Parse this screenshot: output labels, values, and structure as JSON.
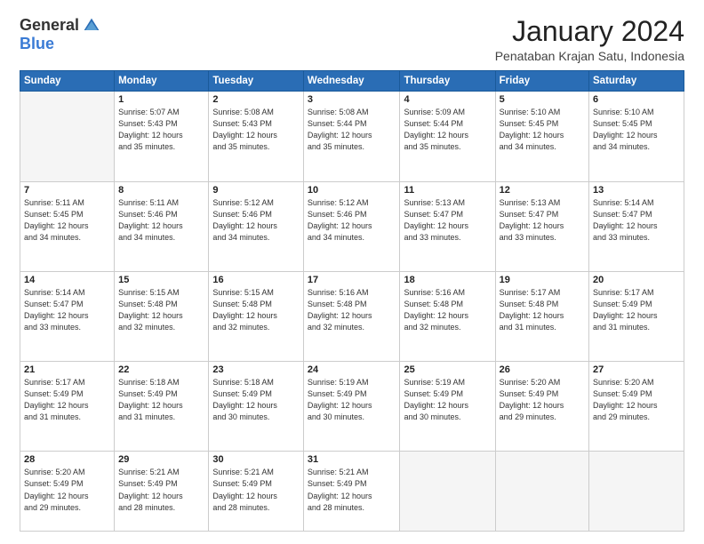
{
  "logo": {
    "general": "General",
    "blue": "Blue"
  },
  "header": {
    "month": "January 2024",
    "location": "Penataban Krajan Satu, Indonesia"
  },
  "columns": [
    "Sunday",
    "Monday",
    "Tuesday",
    "Wednesday",
    "Thursday",
    "Friday",
    "Saturday"
  ],
  "weeks": [
    [
      {
        "day": "",
        "info": ""
      },
      {
        "day": "1",
        "info": "Sunrise: 5:07 AM\nSunset: 5:43 PM\nDaylight: 12 hours\nand 35 minutes."
      },
      {
        "day": "2",
        "info": "Sunrise: 5:08 AM\nSunset: 5:43 PM\nDaylight: 12 hours\nand 35 minutes."
      },
      {
        "day": "3",
        "info": "Sunrise: 5:08 AM\nSunset: 5:44 PM\nDaylight: 12 hours\nand 35 minutes."
      },
      {
        "day": "4",
        "info": "Sunrise: 5:09 AM\nSunset: 5:44 PM\nDaylight: 12 hours\nand 35 minutes."
      },
      {
        "day": "5",
        "info": "Sunrise: 5:10 AM\nSunset: 5:45 PM\nDaylight: 12 hours\nand 34 minutes."
      },
      {
        "day": "6",
        "info": "Sunrise: 5:10 AM\nSunset: 5:45 PM\nDaylight: 12 hours\nand 34 minutes."
      }
    ],
    [
      {
        "day": "7",
        "info": "Sunrise: 5:11 AM\nSunset: 5:45 PM\nDaylight: 12 hours\nand 34 minutes."
      },
      {
        "day": "8",
        "info": "Sunrise: 5:11 AM\nSunset: 5:46 PM\nDaylight: 12 hours\nand 34 minutes."
      },
      {
        "day": "9",
        "info": "Sunrise: 5:12 AM\nSunset: 5:46 PM\nDaylight: 12 hours\nand 34 minutes."
      },
      {
        "day": "10",
        "info": "Sunrise: 5:12 AM\nSunset: 5:46 PM\nDaylight: 12 hours\nand 34 minutes."
      },
      {
        "day": "11",
        "info": "Sunrise: 5:13 AM\nSunset: 5:47 PM\nDaylight: 12 hours\nand 33 minutes."
      },
      {
        "day": "12",
        "info": "Sunrise: 5:13 AM\nSunset: 5:47 PM\nDaylight: 12 hours\nand 33 minutes."
      },
      {
        "day": "13",
        "info": "Sunrise: 5:14 AM\nSunset: 5:47 PM\nDaylight: 12 hours\nand 33 minutes."
      }
    ],
    [
      {
        "day": "14",
        "info": "Sunrise: 5:14 AM\nSunset: 5:47 PM\nDaylight: 12 hours\nand 33 minutes."
      },
      {
        "day": "15",
        "info": "Sunrise: 5:15 AM\nSunset: 5:48 PM\nDaylight: 12 hours\nand 32 minutes."
      },
      {
        "day": "16",
        "info": "Sunrise: 5:15 AM\nSunset: 5:48 PM\nDaylight: 12 hours\nand 32 minutes."
      },
      {
        "day": "17",
        "info": "Sunrise: 5:16 AM\nSunset: 5:48 PM\nDaylight: 12 hours\nand 32 minutes."
      },
      {
        "day": "18",
        "info": "Sunrise: 5:16 AM\nSunset: 5:48 PM\nDaylight: 12 hours\nand 32 minutes."
      },
      {
        "day": "19",
        "info": "Sunrise: 5:17 AM\nSunset: 5:48 PM\nDaylight: 12 hours\nand 31 minutes."
      },
      {
        "day": "20",
        "info": "Sunrise: 5:17 AM\nSunset: 5:49 PM\nDaylight: 12 hours\nand 31 minutes."
      }
    ],
    [
      {
        "day": "21",
        "info": "Sunrise: 5:17 AM\nSunset: 5:49 PM\nDaylight: 12 hours\nand 31 minutes."
      },
      {
        "day": "22",
        "info": "Sunrise: 5:18 AM\nSunset: 5:49 PM\nDaylight: 12 hours\nand 31 minutes."
      },
      {
        "day": "23",
        "info": "Sunrise: 5:18 AM\nSunset: 5:49 PM\nDaylight: 12 hours\nand 30 minutes."
      },
      {
        "day": "24",
        "info": "Sunrise: 5:19 AM\nSunset: 5:49 PM\nDaylight: 12 hours\nand 30 minutes."
      },
      {
        "day": "25",
        "info": "Sunrise: 5:19 AM\nSunset: 5:49 PM\nDaylight: 12 hours\nand 30 minutes."
      },
      {
        "day": "26",
        "info": "Sunrise: 5:20 AM\nSunset: 5:49 PM\nDaylight: 12 hours\nand 29 minutes."
      },
      {
        "day": "27",
        "info": "Sunrise: 5:20 AM\nSunset: 5:49 PM\nDaylight: 12 hours\nand 29 minutes."
      }
    ],
    [
      {
        "day": "28",
        "info": "Sunrise: 5:20 AM\nSunset: 5:49 PM\nDaylight: 12 hours\nand 29 minutes."
      },
      {
        "day": "29",
        "info": "Sunrise: 5:21 AM\nSunset: 5:49 PM\nDaylight: 12 hours\nand 28 minutes."
      },
      {
        "day": "30",
        "info": "Sunrise: 5:21 AM\nSunset: 5:49 PM\nDaylight: 12 hours\nand 28 minutes."
      },
      {
        "day": "31",
        "info": "Sunrise: 5:21 AM\nSunset: 5:49 PM\nDaylight: 12 hours\nand 28 minutes."
      },
      {
        "day": "",
        "info": ""
      },
      {
        "day": "",
        "info": ""
      },
      {
        "day": "",
        "info": ""
      }
    ]
  ]
}
